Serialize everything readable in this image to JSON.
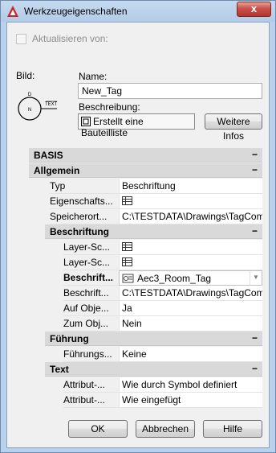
{
  "window": {
    "title": "Werkzeugeigenschaften",
    "close_label": "x"
  },
  "top": {
    "update_from_label": "Aktualisieren von:",
    "image_label": "Bild:",
    "name_label": "Name:",
    "name_value": "New_Tag",
    "description_label": "Beschreibung:",
    "description_value": "Erstellt eine Bauteilliste",
    "more_info_button": "Weitere Infos",
    "preview_text": "TEXT",
    "preview_circle_text": "N",
    "preview_top_text": "D"
  },
  "grid": {
    "basis": {
      "label": "BASIS",
      "toggle": "−"
    },
    "allgemein": {
      "label": "Allgemein",
      "toggle": "−",
      "rows": [
        {
          "name": "Typ",
          "value": "Beschriftung"
        },
        {
          "name": "Eigenschafts...",
          "value": "",
          "icon": "table-icon"
        },
        {
          "name": "Speicherort...",
          "value": "C:\\TESTDATA\\Drawings\\TagCompl..."
        }
      ]
    },
    "beschriftung": {
      "label": "Beschriftung",
      "toggle": "−",
      "rows": [
        {
          "name": "Layer-Sc...",
          "value": "",
          "icon": "table-icon"
        },
        {
          "name": "Layer-Sc...",
          "value": "",
          "icon": "table-icon"
        },
        {
          "name": "Beschrift...",
          "value": "Aec3_Room_Tag",
          "icon": "tag-icon"
        },
        {
          "name": "Beschrift...",
          "value": "C:\\TESTDATA\\Drawings\\TagCompl..."
        },
        {
          "name": "Auf Obje...",
          "value": "Ja"
        },
        {
          "name": "Zum Obj...",
          "value": "Nein"
        }
      ]
    },
    "fuehrung": {
      "label": "Führung",
      "toggle": "−",
      "rows": [
        {
          "name": "Führungs...",
          "value": "Keine"
        }
      ]
    },
    "text": {
      "label": "Text",
      "toggle": "−",
      "rows": [
        {
          "name": "Attribut-...",
          "value": "Wie durch Symbol definiert"
        },
        {
          "name": "Attribut-...",
          "value": "Wie eingefügt"
        }
      ]
    }
  },
  "buttons": {
    "ok": "OK",
    "cancel": "Abbrechen",
    "help": "Hilfe"
  },
  "colors": {
    "frame": "#b9d1ea",
    "close": "#c75050",
    "category_bg": "#d9d9d9"
  }
}
